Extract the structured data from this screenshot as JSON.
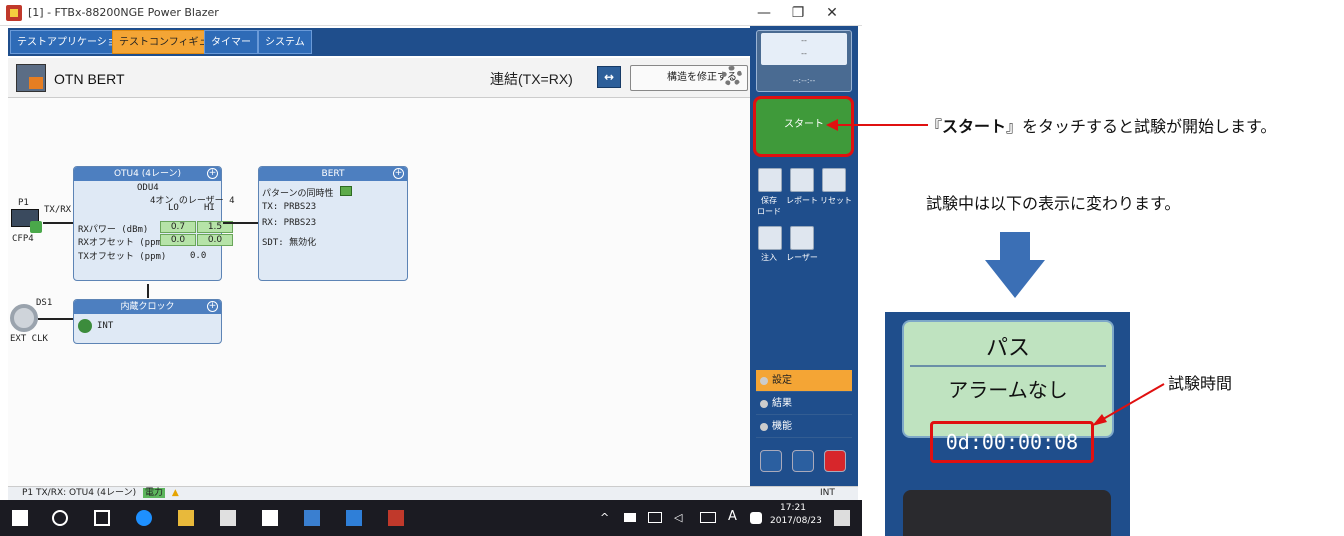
{
  "window": {
    "title": "[1] - FTBx-88200NGE Power Blazer",
    "min": "—",
    "max": "❐",
    "close": "✕"
  },
  "tabs": [
    {
      "label": "テストアプリケーション"
    },
    {
      "label": "テストコンフィギュレータ"
    },
    {
      "label": "タイマー"
    },
    {
      "label": "システム"
    }
  ],
  "header": {
    "title": "OTN BERT",
    "link_label": "連結(TX=RX)",
    "link_icon": "↔",
    "fix_button": "構造を修正する"
  },
  "port": {
    "name": "P1",
    "txrx": "TX/RX",
    "module": "CFP4",
    "ds1": "DS1",
    "ext_clk": "EXT CLK"
  },
  "otu": {
    "title": "OTU4 (4レーン)",
    "odu": "ODU4",
    "laser": "4オン のレーザー 4",
    "lo": "LO",
    "hi": "HI",
    "rx_power_label": "RXパワー (dBm)",
    "rx_power_lo": "0.7",
    "rx_power_hi": "1.5",
    "rx_offset_label": "RXオフセット (ppm)",
    "rx_offset_lo": "0.0",
    "rx_offset_hi": "0.0",
    "tx_offset_label": "TXオフセット (ppm)",
    "tx_offset_val": "0.0"
  },
  "bert": {
    "title": "BERT",
    "sync": "パターンの同時性",
    "tx": "TX: PRBS23",
    "rx": "RX: PRBS23",
    "sdt": "SDT: 無効化"
  },
  "clock": {
    "title": "内蔵クロック",
    "value": "INT"
  },
  "right_panel": {
    "status_line1": "--",
    "status_line2": "--",
    "status_time": "--:--:--",
    "start": "スタート",
    "save_load": "保存\nロード",
    "report": "レポート",
    "reset": "リセット",
    "inject": "注入",
    "laser": "レーザー",
    "nav": {
      "settings": "設定",
      "results": "結果",
      "functions": "機能"
    }
  },
  "statusbar": {
    "text": "P1 TX/RX: OTU4 (4レーン)",
    "power": "電力",
    "int": "INT"
  },
  "taskbar": {
    "time": "17:21",
    "date": "2017/08/23",
    "ime": "A"
  },
  "annotations": {
    "start_note_prefix": "『",
    "start_note_bold": "スタート",
    "start_note_suffix": "』をタッチすると試験が開始します。",
    "during_note": "試験中は以下の表示に変わります。",
    "time_label": "試験時間"
  },
  "inset": {
    "pass": "パス",
    "alarm": "アラームなし",
    "elapsed": "0d:00:00:08"
  },
  "colors": {
    "accent": "#f4a535",
    "panel": "#1f4e8c",
    "start": "#3f9a3a",
    "highlight": "#e01010"
  }
}
